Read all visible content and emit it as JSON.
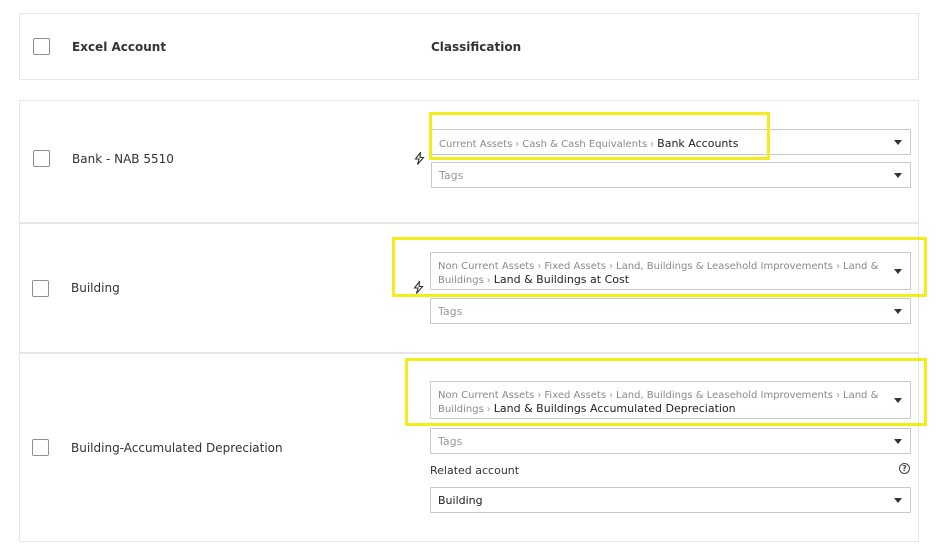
{
  "header": {
    "account_label": "Excel Account",
    "classification_label": "Classification"
  },
  "rows": [
    {
      "account": "Bank - NAB 5510",
      "classification_path": [
        "Current Assets",
        "Cash & Cash Equivalents"
      ],
      "classification_leaf": "Bank Accounts",
      "tags_placeholder": "Tags"
    },
    {
      "account": "Building",
      "classification_path": [
        "Non Current Assets",
        "Fixed Assets",
        "Land, Buildings & Leasehold Improvements",
        "Land & Buildings"
      ],
      "classification_leaf": "Land & Buildings at Cost",
      "tags_placeholder": "Tags"
    },
    {
      "account": "Building-Accumulated Depreciation",
      "classification_path": [
        "Non Current Assets",
        "Fixed Assets",
        "Land, Buildings & Leasehold Improvements",
        "Land & Buildings"
      ],
      "classification_leaf": "Land & Buildings Accumulated Depreciation",
      "tags_placeholder": "Tags",
      "related_account_label": "Related account",
      "related_account_value": "Building"
    }
  ],
  "icons": {
    "bolt": "lightning-bolt-icon",
    "help": "question-circle-icon",
    "caret": "chevron-down-icon"
  },
  "colors": {
    "highlight": "#f4ec1b",
    "border": "#c8c8c8"
  }
}
